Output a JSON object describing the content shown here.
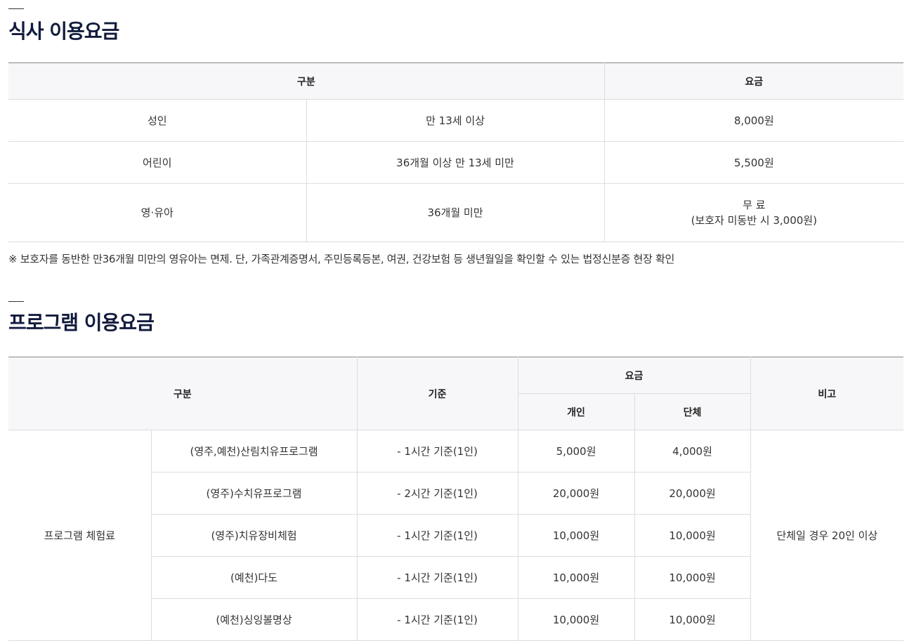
{
  "meal_section": {
    "title": "식사 이용요금",
    "headers": {
      "category": "구분",
      "fee": "요금"
    },
    "rows": [
      {
        "type": "성인",
        "condition": "만 13세 이상",
        "fee": "8,000원",
        "fee_note": ""
      },
      {
        "type": "어린이",
        "condition": "36개월 이상 만 13세 미만",
        "fee": "5,500원",
        "fee_note": ""
      },
      {
        "type": "영·유아",
        "condition": "36개월 미만",
        "fee": "무 료",
        "fee_note": "(보호자 미동반 시 3,000원)"
      }
    ],
    "note": "※ 보호자를 동반한 만36개월 미만의 영유아는 면제. 단, 가족관계증명서, 주민등록등본, 여권, 건강보험 등 생년월일을 확인할 수 있는 법정신분증 현장 확인"
  },
  "program_section": {
    "title": "프로그램 이용요금",
    "headers": {
      "category": "구분",
      "standard": "기준",
      "fee": "요금",
      "individual": "개인",
      "group": "단체",
      "remarks": "비고"
    },
    "group_label": "프로그램 체험료",
    "remark": "단체일 경우 20인 이상",
    "rows": [
      {
        "name": "(영주,예천)산림치유프로그램",
        "standard": "- 1시간 기준(1인)",
        "individual": "5,000원",
        "group": "4,000원"
      },
      {
        "name": "(영주)수치유프로그램",
        "standard": "- 2시간 기준(1인)",
        "individual": "20,000원",
        "group": "20,000원"
      },
      {
        "name": "(영주)치유장비체험",
        "standard": "- 1시간 기준(1인)",
        "individual": "10,000원",
        "group": "10,000원"
      },
      {
        "name": "(예천)다도",
        "standard": "- 1시간 기준(1인)",
        "individual": "10,000원",
        "group": "10,000원"
      },
      {
        "name": "(예천)싱잉볼명상",
        "standard": "- 1시간 기준(1인)",
        "individual": "10,000원",
        "group": "10,000원"
      }
    ]
  },
  "colors": {
    "title": "#111b3d",
    "header_bg": "#f7f7fa",
    "border": "#dddddd",
    "top_border": "#888888"
  }
}
